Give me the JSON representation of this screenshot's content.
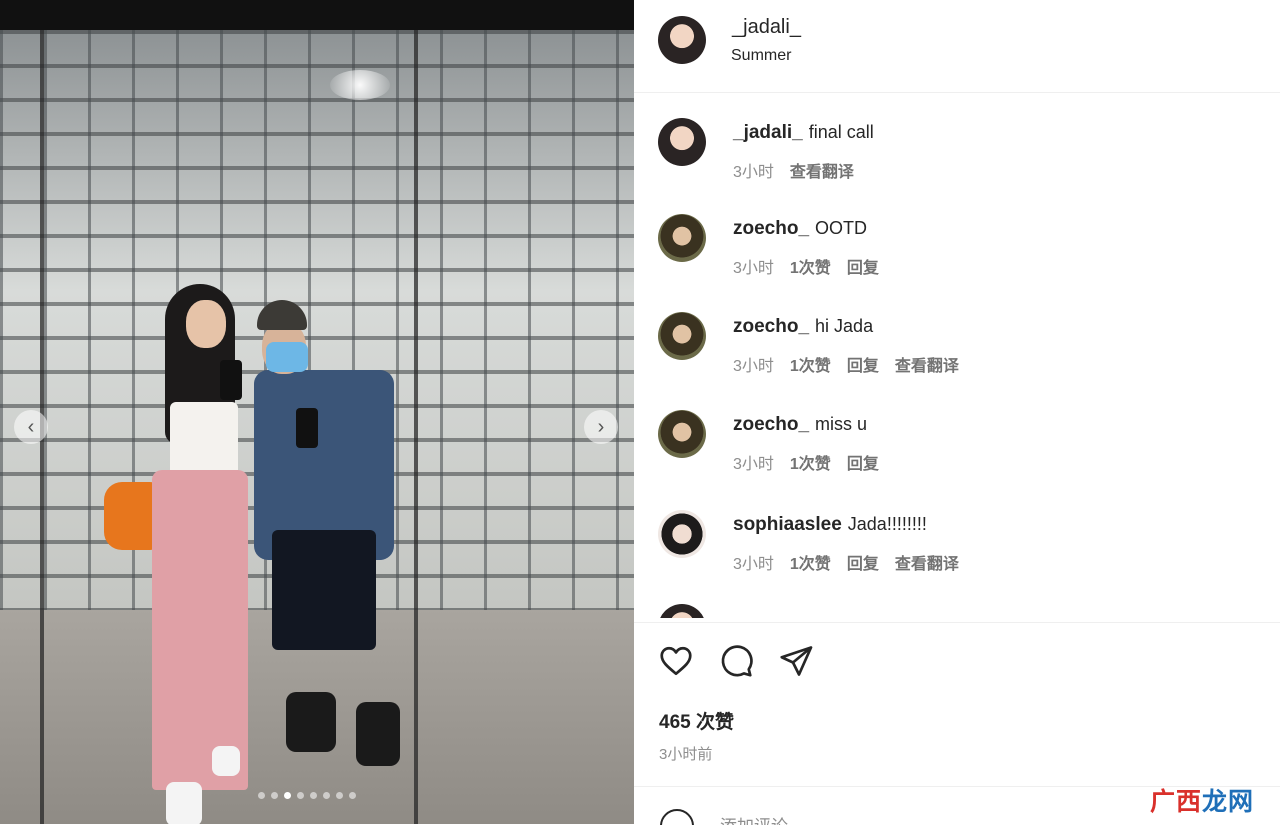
{
  "post": {
    "username": "_jadali_",
    "location": "Summer",
    "carousel": {
      "total": 8,
      "active_index": 2
    }
  },
  "comments": [
    {
      "username": "_jadali_",
      "text": "final call",
      "time": "3小时",
      "likes": "",
      "reply": "",
      "translate": "查看翻译",
      "avatar": "avatar-woman"
    },
    {
      "username": "zoecho_",
      "text": "OOTD",
      "time": "3小时",
      "likes": "1次赞",
      "reply": "回复",
      "translate": "",
      "avatar": "avatar-zoe"
    },
    {
      "username": "zoecho_",
      "text": "hi Jada",
      "time": "3小时",
      "likes": "1次赞",
      "reply": "回复",
      "translate": "查看翻译",
      "avatar": "avatar-zoe"
    },
    {
      "username": "zoecho_",
      "text": "miss u",
      "time": "3小时",
      "likes": "1次赞",
      "reply": "回复",
      "translate": "",
      "avatar": "avatar-zoe"
    },
    {
      "username": "sophiaaslee",
      "text": "Jada!!!!!!!!",
      "time": "3小时",
      "likes": "1次赞",
      "reply": "回复",
      "translate": "查看翻译",
      "avatar": "avatar-sophia"
    }
  ],
  "actions": {
    "like_icon": "heart-icon",
    "comment_icon": "speech-bubble-icon",
    "share_icon": "paper-plane-icon"
  },
  "likes_count": "465 次赞",
  "posted_time": "3小时前",
  "add_comment": {
    "placeholder": "添加评论..."
  },
  "watermark": {
    "part1": "广西",
    "part2": "龙网"
  },
  "colors": {
    "text": "#262626",
    "secondary": "#8e8e8e",
    "border": "#efefef",
    "watermark_red": "#d9302b",
    "watermark_blue": "#1f6fb8"
  }
}
